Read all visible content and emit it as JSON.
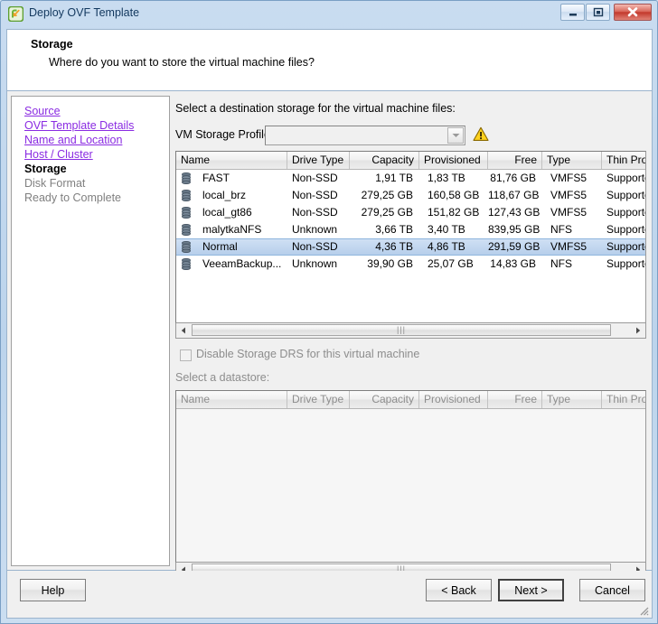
{
  "window": {
    "title": "Deploy OVF Template",
    "icon": "ovf-template-icon",
    "minimize_label": "Minimize",
    "maximize_label": "Maximize",
    "close_label": "Close"
  },
  "header": {
    "title": "Storage",
    "subtitle": "Where do you want to store the virtual machine files?"
  },
  "nav": {
    "items": [
      {
        "label": "Source",
        "state": "link"
      },
      {
        "label": "OVF Template Details",
        "state": "link"
      },
      {
        "label": "Name and Location",
        "state": "link"
      },
      {
        "label": "Host / Cluster",
        "state": "link"
      },
      {
        "label": "Storage",
        "state": "current"
      },
      {
        "label": "Disk Format",
        "state": "future"
      },
      {
        "label": "Ready to Complete",
        "state": "future"
      }
    ]
  },
  "content": {
    "instruction": "Select a destination storage for the virtual machine files:",
    "profile_label": "VM Storage Profile:",
    "profile_value": "",
    "profile_warning_icon": "warning-icon",
    "drs_checkbox_label": "Disable Storage DRS for this virtual machine",
    "drs_checked": false,
    "datastore_label": "Select a datastore:"
  },
  "table": {
    "columns": [
      "Name",
      "Drive Type",
      "Capacity",
      "Provisioned",
      "Free",
      "Type",
      "Thin Prov"
    ],
    "rows": [
      {
        "name": "FAST",
        "drive_type": "Non-SSD",
        "capacity": "1,91 TB",
        "provisioned": "1,83 TB",
        "free": "81,76 GB",
        "type": "VMFS5",
        "thin": "Supporte",
        "selected": false
      },
      {
        "name": "local_brz",
        "drive_type": "Non-SSD",
        "capacity": "279,25 GB",
        "provisioned": "160,58 GB",
        "free": "118,67 GB",
        "type": "VMFS5",
        "thin": "Supporte",
        "selected": false
      },
      {
        "name": "local_gt86",
        "drive_type": "Non-SSD",
        "capacity": "279,25 GB",
        "provisioned": "151,82 GB",
        "free": "127,43 GB",
        "type": "VMFS5",
        "thin": "Supporte",
        "selected": false
      },
      {
        "name": "malytkaNFS",
        "drive_type": "Unknown",
        "capacity": "3,66 TB",
        "provisioned": "3,40 TB",
        "free": "839,95 GB",
        "type": "NFS",
        "thin": "Supporte",
        "selected": false
      },
      {
        "name": "Normal",
        "drive_type": "Non-SSD",
        "capacity": "4,36 TB",
        "provisioned": "4,86 TB",
        "free": "291,59 GB",
        "type": "VMFS5",
        "thin": "Supporte",
        "selected": true
      },
      {
        "name": "VeeamBackup...",
        "drive_type": "Unknown",
        "capacity": "39,90 GB",
        "provisioned": "25,07 GB",
        "free": "14,83 GB",
        "type": "NFS",
        "thin": "Supporte",
        "selected": false
      }
    ]
  },
  "table2": {
    "columns": [
      "Name",
      "Drive Type",
      "Capacity",
      "Provisioned",
      "Free",
      "Type",
      "Thin Provi"
    ],
    "rows": []
  },
  "footer": {
    "help": "Help",
    "back": "< Back",
    "next": "Next >",
    "cancel": "Cancel"
  },
  "colors": {
    "link": "#8a2be2",
    "selection": "#b7cfeb",
    "warning": "#ffcc00",
    "titlebar_text": "#12385e"
  }
}
